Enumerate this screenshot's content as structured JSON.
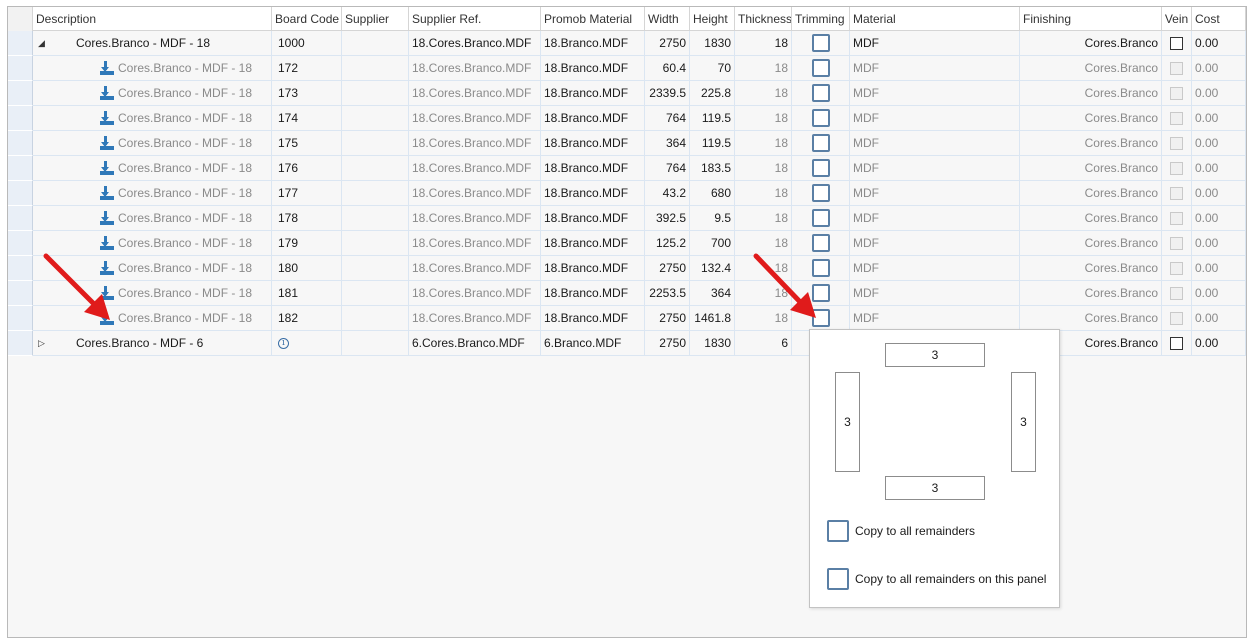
{
  "columns": [
    "Description",
    "Board Code",
    "Supplier",
    "Supplier Ref.",
    "Promob Material",
    "Width",
    "Height",
    "Thickness",
    "Trimming",
    "Material",
    "Finishing",
    "Vein",
    "Cost"
  ],
  "rows": [
    {
      "kind": "parent-expanded",
      "desc": "Cores.Branco - MDF - 18",
      "code": "1000",
      "sref": "18.Cores.Branco.MDF",
      "pmat": "18.Branco.MDF",
      "w": "2750",
      "h": "1830",
      "t": "18",
      "mat": "MDF",
      "fin": "Cores.Branco",
      "cost": "0.00"
    },
    {
      "kind": "child",
      "desc": "Cores.Branco - MDF - 18",
      "code": "172",
      "sref": "18.Cores.Branco.MDF",
      "pmat": "18.Branco.MDF",
      "w": "60.4",
      "h": "70",
      "t": "18",
      "mat": "MDF",
      "fin": "Cores.Branco",
      "cost": "0.00"
    },
    {
      "kind": "child",
      "desc": "Cores.Branco - MDF - 18",
      "code": "173",
      "sref": "18.Cores.Branco.MDF",
      "pmat": "18.Branco.MDF",
      "w": "2339.5",
      "h": "225.8",
      "t": "18",
      "mat": "MDF",
      "fin": "Cores.Branco",
      "cost": "0.00"
    },
    {
      "kind": "child",
      "desc": "Cores.Branco - MDF - 18",
      "code": "174",
      "sref": "18.Cores.Branco.MDF",
      "pmat": "18.Branco.MDF",
      "w": "764",
      "h": "119.5",
      "t": "18",
      "mat": "MDF",
      "fin": "Cores.Branco",
      "cost": "0.00"
    },
    {
      "kind": "child",
      "desc": "Cores.Branco - MDF - 18",
      "code": "175",
      "sref": "18.Cores.Branco.MDF",
      "pmat": "18.Branco.MDF",
      "w": "364",
      "h": "119.5",
      "t": "18",
      "mat": "MDF",
      "fin": "Cores.Branco",
      "cost": "0.00"
    },
    {
      "kind": "child",
      "desc": "Cores.Branco - MDF - 18",
      "code": "176",
      "sref": "18.Cores.Branco.MDF",
      "pmat": "18.Branco.MDF",
      "w": "764",
      "h": "183.5",
      "t": "18",
      "mat": "MDF",
      "fin": "Cores.Branco",
      "cost": "0.00"
    },
    {
      "kind": "child",
      "desc": "Cores.Branco - MDF - 18",
      "code": "177",
      "sref": "18.Cores.Branco.MDF",
      "pmat": "18.Branco.MDF",
      "w": "43.2",
      "h": "680",
      "t": "18",
      "mat": "MDF",
      "fin": "Cores.Branco",
      "cost": "0.00"
    },
    {
      "kind": "child",
      "desc": "Cores.Branco - MDF - 18",
      "code": "178",
      "sref": "18.Cores.Branco.MDF",
      "pmat": "18.Branco.MDF",
      "w": "392.5",
      "h": "9.5",
      "t": "18",
      "mat": "MDF",
      "fin": "Cores.Branco",
      "cost": "0.00"
    },
    {
      "kind": "child",
      "desc": "Cores.Branco - MDF - 18",
      "code": "179",
      "sref": "18.Cores.Branco.MDF",
      "pmat": "18.Branco.MDF",
      "w": "125.2",
      "h": "700",
      "t": "18",
      "mat": "MDF",
      "fin": "Cores.Branco",
      "cost": "0.00"
    },
    {
      "kind": "child",
      "desc": "Cores.Branco - MDF - 18",
      "code": "180",
      "sref": "18.Cores.Branco.MDF",
      "pmat": "18.Branco.MDF",
      "w": "2750",
      "h": "132.4",
      "t": "18",
      "mat": "MDF",
      "fin": "Cores.Branco",
      "cost": "0.00"
    },
    {
      "kind": "child",
      "desc": "Cores.Branco - MDF - 18",
      "code": "181",
      "sref": "18.Cores.Branco.MDF",
      "pmat": "18.Branco.MDF",
      "w": "2253.5",
      "h": "364",
      "t": "18",
      "mat": "MDF",
      "fin": "Cores.Branco",
      "cost": "0.00"
    },
    {
      "kind": "child",
      "desc": "Cores.Branco - MDF - 18",
      "code": "182",
      "sref": "18.Cores.Branco.MDF",
      "pmat": "18.Branco.MDF",
      "w": "2750",
      "h": "1461.8",
      "t": "18",
      "mat": "MDF",
      "fin": "Cores.Branco",
      "cost": "0.00"
    },
    {
      "kind": "parent-collapsed",
      "desc": "Cores.Branco - MDF - 6",
      "code": "",
      "sref": "6.Cores.Branco.MDF",
      "pmat": "6.Branco.MDF",
      "w": "2750",
      "h": "1830",
      "t": "6",
      "mat": "",
      "fin": "Cores.Branco",
      "cost": "0.00"
    }
  ],
  "glyphs": {
    "expanded": "◢",
    "collapsed": "▷",
    "info": "i"
  },
  "popup": {
    "top": "3",
    "left": "3",
    "right": "3",
    "bottom": "3",
    "copy_all": "Copy to all remainders",
    "copy_panel": "Copy to all remainders on this panel"
  },
  "colors": {
    "annotation_arrow": "#e01b1b",
    "checkbox_border": "#5a7fa5",
    "child_text": "#8a8a8a"
  }
}
